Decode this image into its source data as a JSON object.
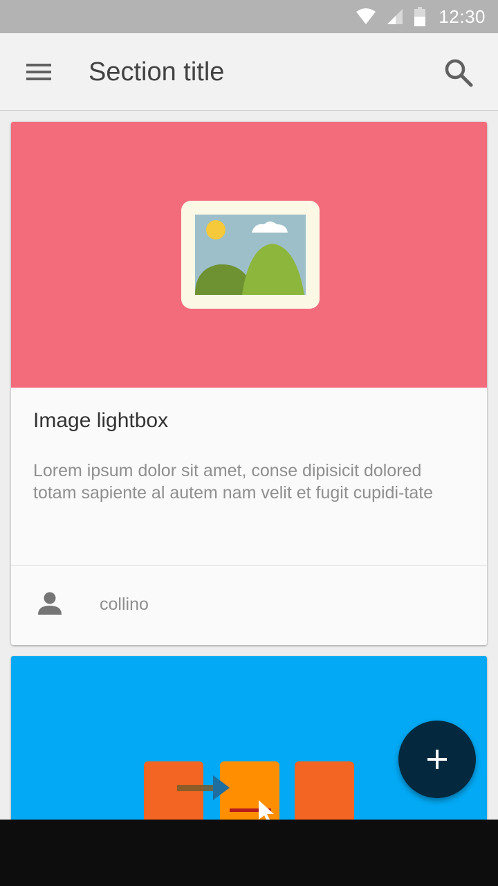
{
  "status_bar": {
    "time": "12:30",
    "icons": [
      "wifi-icon",
      "signal-icon",
      "battery-icon"
    ]
  },
  "app_bar": {
    "title": "Section title",
    "menu_icon": "menu-icon",
    "search_icon": "search-icon"
  },
  "cards": [
    {
      "media_color": "#f36c7c",
      "media_icon": "image-placeholder-icon",
      "title": "Image lightbox",
      "text": "Lorem ipsum dolor sit amet, conse dipisicit dolored totam sapiente al autem nam velit et fugit cupidi-tate",
      "author_icon": "person-icon",
      "author": "collino"
    },
    {
      "media_color": "#03a9f4",
      "media_icon": "flow-illustration"
    }
  ],
  "fab": {
    "icon": "plus-icon",
    "color": "#04293f"
  },
  "colors": {
    "status_bar": "#b3b3b3",
    "app_bar": "#f2f2f2",
    "background": "#eeeeee",
    "nav_bar": "#0d0d0d"
  }
}
